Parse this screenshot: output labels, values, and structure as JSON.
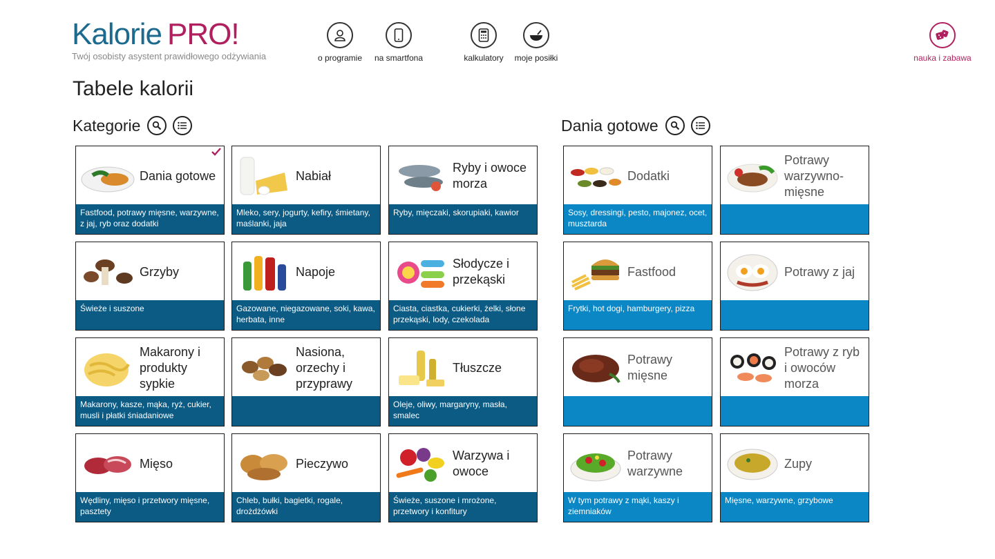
{
  "app": {
    "logo_main": "Kalorie",
    "logo_pro": "PRO!",
    "tagline": "Twój osobisty asystent prawidłowego odżywiania"
  },
  "nav": {
    "about": "o programie",
    "smartphone": "na smartfona",
    "calculators": "kalkulatory",
    "meals": "moje posiłki",
    "fun": "nauka i zabawa"
  },
  "page_title": "Tabele kalorii",
  "sections": {
    "categories": "Kategorie",
    "ready": "Dania gotowe"
  },
  "categories": [
    {
      "name": "Dania gotowe",
      "desc": "Fastfood, potrawy mięsne, warzywne, z jaj, ryb oraz dodatki",
      "icon": "ready-meal-plate"
    },
    {
      "name": "Nabiał",
      "desc": "Mleko, sery, jogurty, kefiry, śmietany, maślanki, jaja",
      "icon": "dairy"
    },
    {
      "name": "Ryby i owoce morza",
      "desc": "Ryby, mięczaki, skorupiaki, kawior",
      "icon": "fish"
    },
    {
      "name": "Grzyby",
      "desc": "Świeże i suszone",
      "icon": "mushrooms"
    },
    {
      "name": "Napoje",
      "desc": "Gazowane, niegazowane, soki, kawa, herbata, inne",
      "icon": "drinks"
    },
    {
      "name": "Słodycze i przekąski",
      "desc": "Ciasta, ciastka, cukierki, żelki, słone przekąski, lody, czekolada",
      "icon": "sweets"
    },
    {
      "name": "Makarony i produkty sypkie",
      "desc": "Makarony, kasze, mąka, ryż, cukier, musli i płatki śniadaniowe",
      "icon": "pasta"
    },
    {
      "name": "Nasiona, orzechy i przyprawy",
      "desc": "",
      "icon": "nuts"
    },
    {
      "name": "Tłuszcze",
      "desc": "Oleje, oliwy, margaryny, masła, smalec",
      "icon": "fats"
    },
    {
      "name": "Mięso",
      "desc": "Wędliny, mięso i przetwory mięsne, pasztety",
      "icon": "meat"
    },
    {
      "name": "Pieczywo",
      "desc": "Chleb, bułki, bagietki, rogale, drożdżówki",
      "icon": "bread"
    },
    {
      "name": "Warzywa i owoce",
      "desc": "Świeże, suszone i mrożone, przetwory i konfitury",
      "icon": "vegetables-fruit"
    }
  ],
  "ready_meals": [
    {
      "name": "Dodatki",
      "desc": "Sosy, dressingi, pesto, majonez, ocet, musztarda",
      "icon": "sauces"
    },
    {
      "name": "Potrawy warzywno-mięsne",
      "desc": "",
      "icon": "meat-veg-dish"
    },
    {
      "name": "Fastfood",
      "desc": "Frytki, hot dogi, hamburgery, pizza",
      "icon": "burger"
    },
    {
      "name": "Potrawy z jaj",
      "desc": "",
      "icon": "eggs"
    },
    {
      "name": "Potrawy mięsne",
      "desc": "",
      "icon": "steak"
    },
    {
      "name": "Potrawy z ryb i owoców morza",
      "desc": "",
      "icon": "sushi"
    },
    {
      "name": "Potrawy warzywne",
      "desc": "W tym potrawy z mąki, kaszy i ziemniaków",
      "icon": "salad"
    },
    {
      "name": "Zupy",
      "desc": "Mięsne, warzywne, grzybowe",
      "icon": "soup"
    }
  ],
  "colors": {
    "brand_blue": "#1d6a8f",
    "brand_pink": "#b01f5e",
    "tile_dark": "#0b5b85",
    "tile_light": "#0b87c6"
  }
}
